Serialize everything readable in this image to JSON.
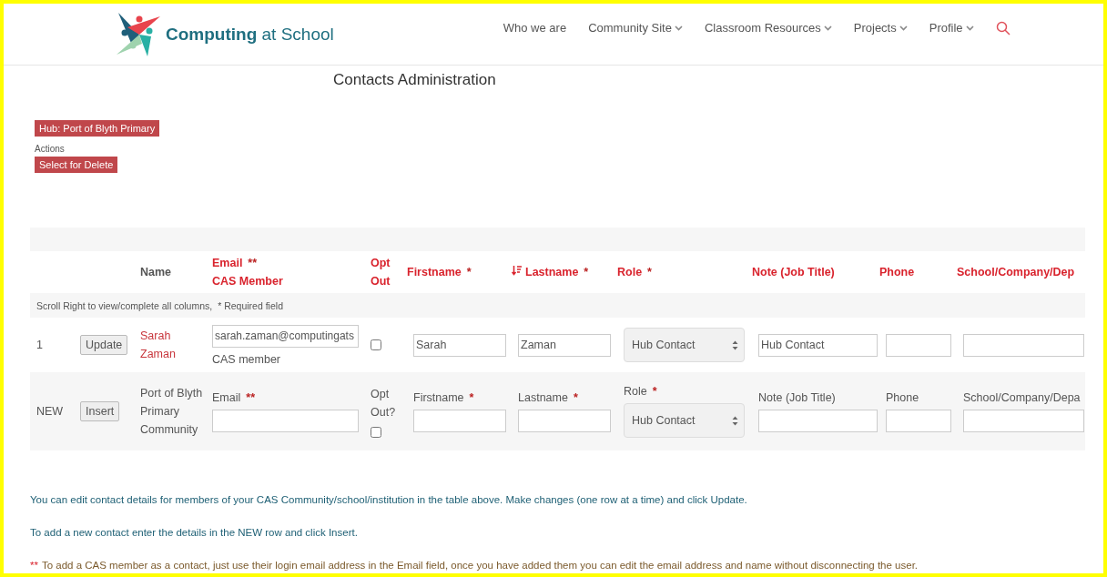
{
  "header": {
    "logo": "**Computing** at School",
    "nav": [
      {
        "label": "Who we are",
        "dropdown": false
      },
      {
        "label": "Community Site",
        "dropdown": true
      },
      {
        "label": "Classroom Resources",
        "dropdown": true
      },
      {
        "label": "Projects",
        "dropdown": true
      },
      {
        "label": "Profile",
        "dropdown": true
      }
    ]
  },
  "title": "Contacts Administration",
  "hub_button": "Hub: Port of Blyth Primary",
  "actions_label": "Actions",
  "delete_button": "Select for Delete",
  "table": {
    "columns": [
      {
        "label": "Name",
        "kind": "plain",
        "sorted": false
      },
      {
        "label": "Email",
        "marker": "**",
        "sub": "CAS Member",
        "kind": "field",
        "sorted": false
      },
      {
        "label": "Opt Out",
        "kind": "field",
        "sorted": false
      },
      {
        "label": "Firstname",
        "marker": "*",
        "kind": "field",
        "sorted": false
      },
      {
        "label": "Lastname",
        "marker": "*",
        "kind": "field",
        "sorted": true
      },
      {
        "label": "Role",
        "marker": "*",
        "kind": "field",
        "sorted": false
      },
      {
        "label": "Note (Job Title)",
        "kind": "field",
        "sorted": false
      },
      {
        "label": "Phone",
        "kind": "field",
        "sorted": false
      },
      {
        "label": "School/Company/Dep",
        "kind": "field",
        "sorted": false
      }
    ],
    "hint": "Scroll Right to view/complete all columns,",
    "required_note": "* Required field",
    "rows": [
      {
        "number": "1",
        "action": "Update",
        "name": "Sarah Zaman",
        "linked": true,
        "email": {
          "value": "sarah.zaman@computingats",
          "note": "CAS member"
        },
        "opt_out": {
          "checked": false
        },
        "fields": [
          {
            "kind": "input",
            "value": "Sarah"
          },
          {
            "kind": "input",
            "value": "Zaman"
          },
          {
            "kind": "select",
            "value": "Hub Contact"
          },
          {
            "kind": "input",
            "value": "Hub Contact"
          },
          {
            "kind": "input"
          },
          {
            "kind": "input"
          }
        ]
      },
      {
        "number": "NEW",
        "action": "Insert",
        "name": "Port of Blyth Primary Community",
        "linked": false,
        "email": {
          "label": "Email",
          "marker": "**"
        },
        "opt_out": {
          "label": "Opt Out?",
          "checked": false
        },
        "fields": [
          {
            "kind": "input",
            "label": "Firstname",
            "marker": "*"
          },
          {
            "kind": "input",
            "label": "Lastname",
            "marker": "*"
          },
          {
            "kind": "select",
            "label": "Role",
            "marker": "*",
            "value": "Hub Contact"
          },
          {
            "kind": "input",
            "label": "Note (Job Title)"
          },
          {
            "kind": "input",
            "label": "Phone"
          },
          {
            "kind": "input",
            "label": "School/Company/Depa"
          }
        ]
      }
    ]
  },
  "notes": [
    {
      "kind": "info",
      "text": "You can edit contact details for members of your CAS Community/school/institution in the table above. Make changes (one row at a time) and click Update."
    },
    {
      "kind": "info",
      "text": "To add a new contact enter the details in the NEW row and click Insert."
    },
    {
      "kind": "warning",
      "marker": "**",
      "text": "To add a CAS member as a contact, just use their login email address in the Email field, once you have added them you can edit the email address and name without disconnecting the user."
    }
  ]
}
